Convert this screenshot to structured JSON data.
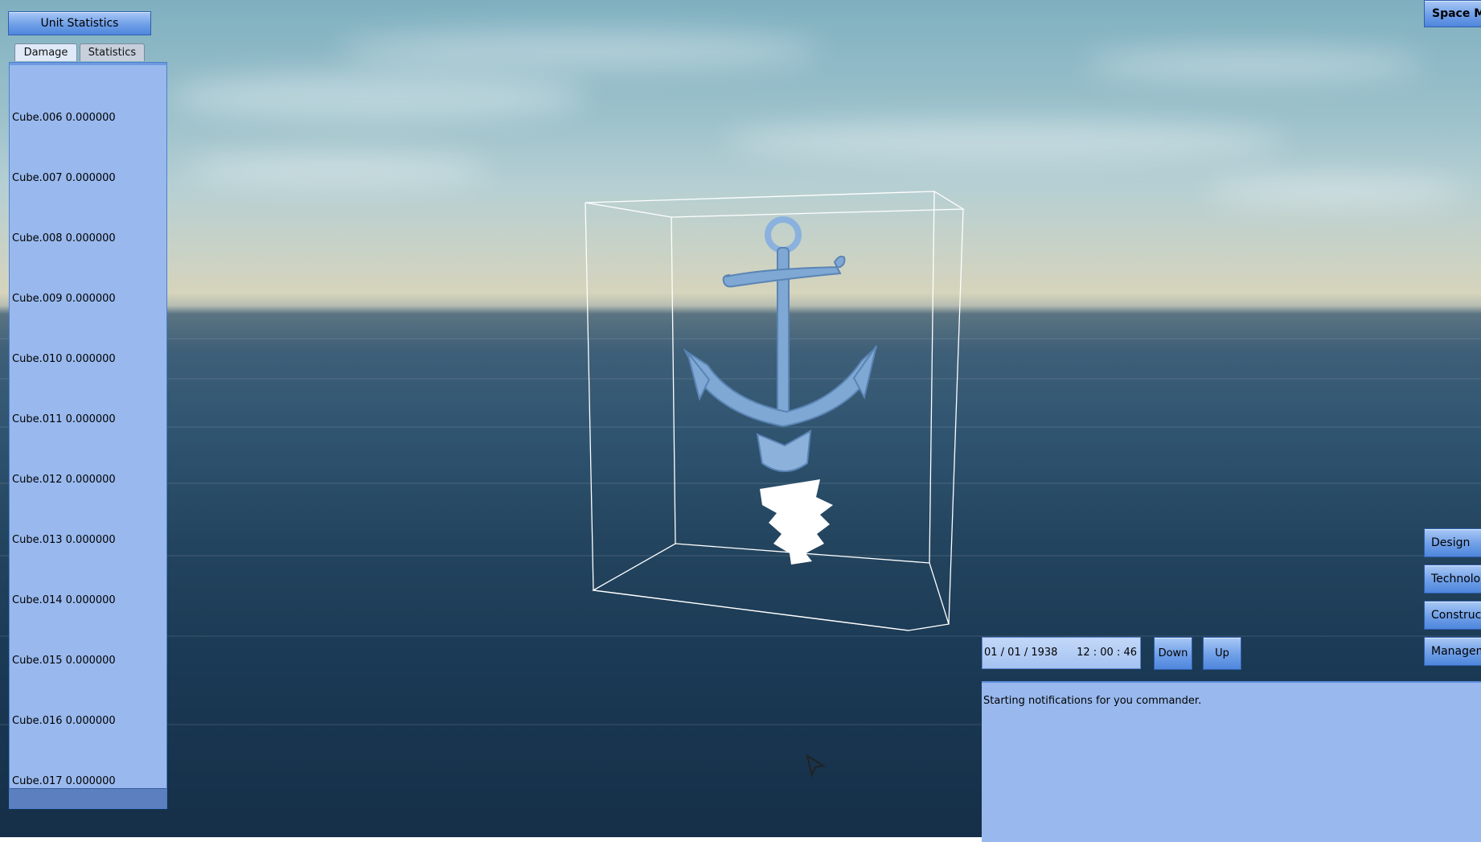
{
  "left_panel": {
    "title_button": "Unit Statistics",
    "tabs": [
      {
        "label": "Damage",
        "active": true
      },
      {
        "label": "Statistics",
        "active": false
      }
    ],
    "damage_rows": [
      "Cube.006 0.000000",
      "Cube.007 0.000000",
      "Cube.008 0.000000",
      "Cube.009 0.000000",
      "Cube.010 0.000000",
      "Cube.011 0.000000",
      "Cube.012 0.000000",
      "Cube.013 0.000000",
      "Cube.014 0.000000",
      "Cube.015 0.000000",
      "Cube.016 0.000000",
      "Cube.017 0.000000"
    ]
  },
  "right_panel": {
    "space_button": "Space Ma",
    "side_buttons": [
      "Design",
      "Technolog",
      "Constructi",
      "Manageme"
    ]
  },
  "time_controls": {
    "date": "01 / 01 / 1938",
    "time": "12 : 00 : 46",
    "down_label": "Down",
    "up_label": "Up"
  },
  "notifications": {
    "message": "Starting notifications for you commander."
  },
  "colors": {
    "panel_bg": "#99b9ee",
    "button_bg": "#6f9fe8",
    "sea_dark": "#1b3a55"
  },
  "icons": [
    "anchor-icon",
    "mouse-cursor-icon"
  ]
}
